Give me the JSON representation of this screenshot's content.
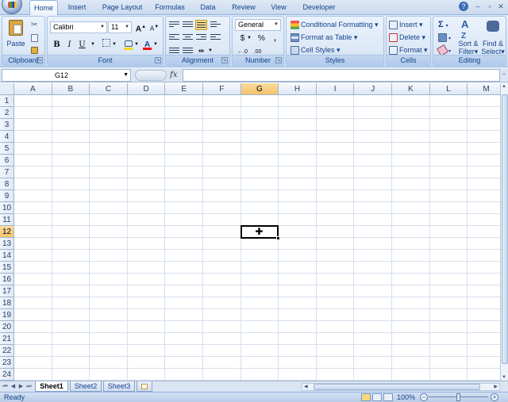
{
  "tabs": [
    {
      "label": "Home",
      "active": true
    },
    {
      "label": "Insert"
    },
    {
      "label": "Page Layout"
    },
    {
      "label": "Formulas"
    },
    {
      "label": "Data"
    },
    {
      "label": "Review"
    },
    {
      "label": "View"
    },
    {
      "label": "Developer"
    }
  ],
  "ribbon": {
    "clipboard": {
      "label": "Clipboard",
      "paste": "Paste"
    },
    "font": {
      "label": "Font",
      "font_name": "Calibri",
      "font_size": "11",
      "bold": "B",
      "italic": "I",
      "underline": "U",
      "grow": "A",
      "shrink": "A",
      "fill_color": "#ffd700",
      "font_color": "#ff0000"
    },
    "alignment": {
      "label": "Alignment"
    },
    "number": {
      "label": "Number",
      "format": "General",
      "currency": "$",
      "percent": "%",
      "comma": ","
    },
    "styles": {
      "label": "Styles",
      "conditional": "Conditional Formatting",
      "table": "Format as Table",
      "cell_styles": "Cell Styles"
    },
    "cells": {
      "label": "Cells",
      "insert": "Insert",
      "delete": "Delete",
      "format": "Format"
    },
    "editing": {
      "label": "Editing",
      "sigma": "Σ",
      "sort": "Sort &",
      "sort2": "Filter",
      "find": "Find &",
      "find2": "Select"
    }
  },
  "formula_bar": {
    "name_box": "G12",
    "fx": "fx",
    "value": ""
  },
  "grid": {
    "columns": [
      "A",
      "B",
      "C",
      "D",
      "E",
      "F",
      "G",
      "H",
      "I",
      "J",
      "K",
      "L",
      "M"
    ],
    "rows": [
      "1",
      "2",
      "3",
      "4",
      "5",
      "6",
      "7",
      "8",
      "9",
      "10",
      "11",
      "12",
      "13",
      "14",
      "15",
      "16",
      "17",
      "18",
      "19",
      "20",
      "21",
      "22",
      "23",
      "24"
    ],
    "selected_column": "G",
    "selected_row": "12"
  },
  "sheets": [
    {
      "label": "Sheet1",
      "active": true
    },
    {
      "label": "Sheet2"
    },
    {
      "label": "Sheet3"
    }
  ],
  "status": {
    "text": "Ready",
    "zoom": "100%",
    "zoom_out": "−",
    "zoom_in": "+"
  }
}
